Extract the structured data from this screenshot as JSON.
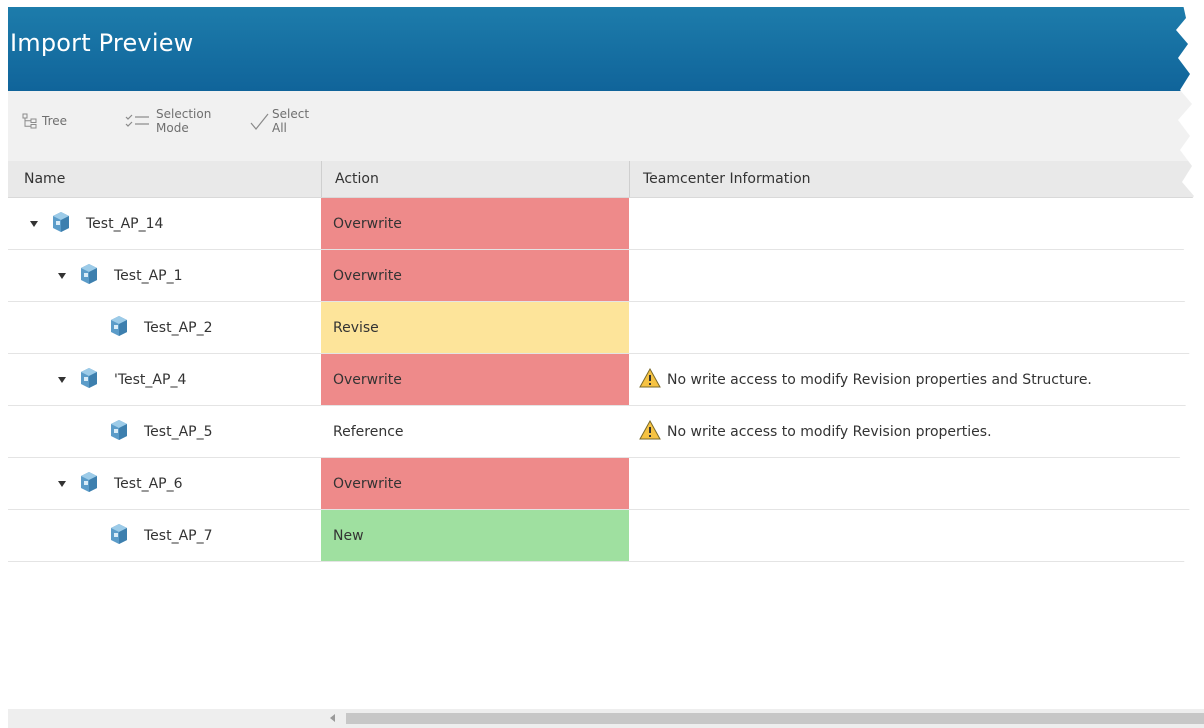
{
  "window": {
    "title": "Import Preview"
  },
  "toolbar": {
    "tree_label": "Tree",
    "selection_mode_line1": "Selection",
    "selection_mode_line2": "Mode",
    "select_all_line1": "Select",
    "select_all_line2": "All"
  },
  "columns": {
    "name": "Name",
    "action": "Action",
    "info": "Teamcenter Information"
  },
  "rows": [
    {
      "name": "Test_AP_14",
      "indent": 0,
      "expanded": true,
      "action": "Overwrite",
      "info": ""
    },
    {
      "name": "Test_AP_1",
      "indent": 1,
      "expanded": true,
      "action": "Overwrite",
      "info": ""
    },
    {
      "name": "Test_AP_2",
      "indent": 2,
      "expanded": false,
      "action": "Revise",
      "info": ""
    },
    {
      "name": "'Test_AP_4",
      "indent": 1,
      "expanded": true,
      "action": "Overwrite",
      "info": "No write access to modify Revision properties and Structure."
    },
    {
      "name": "Test_AP_5",
      "indent": 2,
      "expanded": false,
      "action": "Reference",
      "info": "No write access to modify Revision properties."
    },
    {
      "name": "Test_AP_6",
      "indent": 1,
      "expanded": true,
      "action": "Overwrite",
      "info": ""
    },
    {
      "name": "Test_AP_7",
      "indent": 2,
      "expanded": false,
      "action": "New",
      "info": ""
    }
  ],
  "colors": {
    "title_bar": "#10649a",
    "overwrite": "#ee8a8a",
    "revise": "#fde49a",
    "new": "#9fe0a0",
    "warning": "#f6c343"
  },
  "icons": {
    "tree": "tree-icon",
    "selection_mode": "checklist-icon",
    "select_all": "checkmark-icon",
    "expander": "chevron-down-icon",
    "part": "part-assembly-icon",
    "warning": "warning-icon"
  }
}
